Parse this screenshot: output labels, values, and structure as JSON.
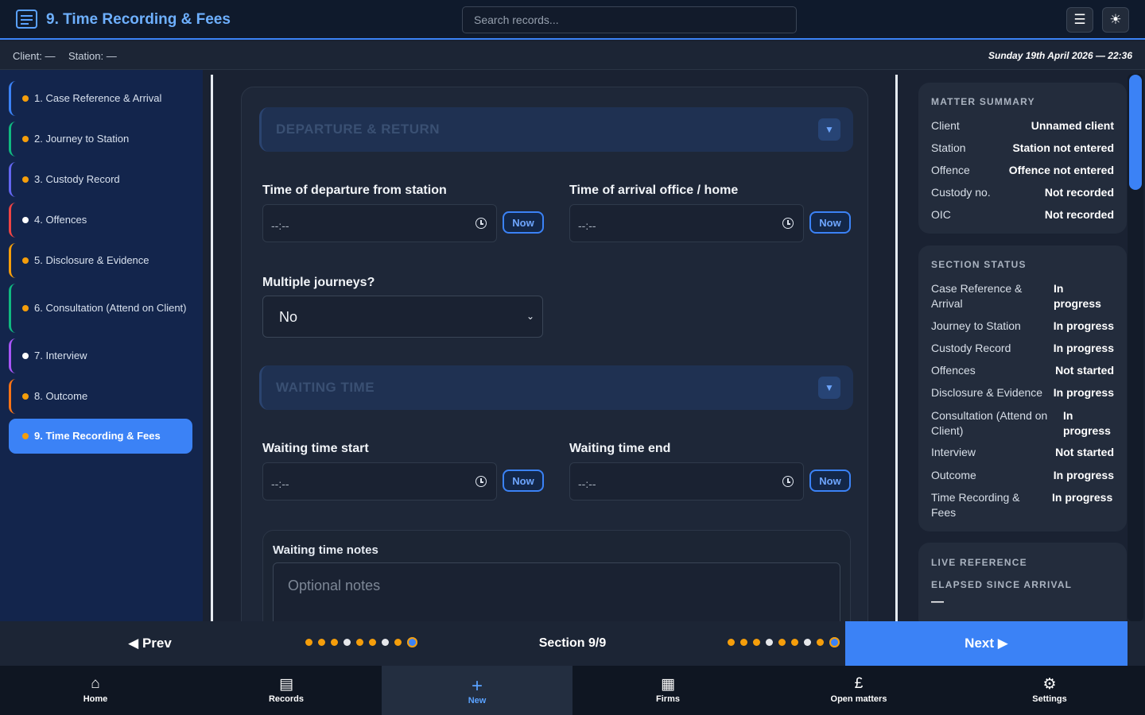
{
  "header": {
    "title": "9. Time Recording & Fees",
    "search_placeholder": "Search records...",
    "menu_icon": "hamburger-icon",
    "theme_icon": "sun-icon"
  },
  "infobar": {
    "client": "Client: —",
    "station": "Station: —",
    "datetime": "Sunday 19th April 2026 — 22:36"
  },
  "sidebar": {
    "items": [
      {
        "label": "1. Case Reference & Arrival",
        "accent": "#3b82f6",
        "dot": "#f59e0b"
      },
      {
        "label": "2. Journey to Station",
        "accent": "#10b981",
        "dot": "#f59e0b"
      },
      {
        "label": "3. Custody Record",
        "accent": "#6366f1",
        "dot": "#f59e0b"
      },
      {
        "label": "4. Offences",
        "accent": "#ef4444",
        "dot": "#ffffff"
      },
      {
        "label": "5. Disclosure & Evidence",
        "accent": "#f59e0b",
        "dot": "#f59e0b"
      },
      {
        "label": "6. Consultation (Attend on Client)",
        "accent": "#10b981",
        "dot": "#f59e0b"
      },
      {
        "label": "7. Interview",
        "accent": "#a855f7",
        "dot": "#ffffff"
      },
      {
        "label": "8. Outcome",
        "accent": "#f97316",
        "dot": "#f59e0b"
      },
      {
        "label": "9. Time Recording & Fees",
        "accent": "#3b82f6",
        "dot": "#f59e0b",
        "active": true
      }
    ]
  },
  "main": {
    "departure_section": {
      "title": "DEPARTURE & RETURN"
    },
    "departure_time": {
      "label": "Time of departure from station",
      "value": "--:--",
      "now": "Now"
    },
    "arrival_time": {
      "label": "Time of arrival office / home",
      "value": "--:--",
      "now": "Now"
    },
    "multiple_journeys": {
      "label": "Multiple journeys?",
      "value": "No"
    },
    "waiting_section": {
      "title": "WAITING TIME"
    },
    "waiting_start": {
      "label": "Waiting time start",
      "value": "--:--",
      "now": "Now"
    },
    "waiting_end": {
      "label": "Waiting time end",
      "value": "--:--",
      "now": "Now"
    },
    "waiting_notes": {
      "label": "Waiting time notes",
      "placeholder": "Optional notes"
    }
  },
  "matter_summary": {
    "title": "MATTER SUMMARY",
    "rows": [
      {
        "key": "Client",
        "value": "Unnamed client"
      },
      {
        "key": "Station",
        "value": "Station not entered"
      },
      {
        "key": "Offence",
        "value": "Offence not entered"
      },
      {
        "key": "Custody no.",
        "value": "Not recorded"
      },
      {
        "key": "OIC",
        "value": "Not recorded"
      }
    ]
  },
  "section_status": {
    "title": "SECTION STATUS",
    "rows": [
      {
        "key": "Case Reference & Arrival",
        "value": "In progress"
      },
      {
        "key": "Journey to Station",
        "value": "In progress"
      },
      {
        "key": "Custody Record",
        "value": "In progress"
      },
      {
        "key": "Offences",
        "value": "Not started"
      },
      {
        "key": "Disclosure & Evidence",
        "value": "In progress"
      },
      {
        "key": "Consultation (Attend on Client)",
        "value": "In progress"
      },
      {
        "key": "Interview",
        "value": "Not started"
      },
      {
        "key": "Outcome",
        "value": "In progress"
      },
      {
        "key": "Time Recording & Fees",
        "value": "In progress"
      }
    ]
  },
  "live_reference": {
    "title": "LIVE REFERENCE",
    "elapsed_label": "ELAPSED SINCE ARRIVAL",
    "elapsed_value": "—"
  },
  "footer": {
    "prev": "◀ Prev",
    "section": "Section 9/9",
    "next": "Next ▶",
    "dot_colors": [
      "#f59e0b",
      "#f59e0b",
      "#f59e0b",
      "#e5e7eb",
      "#f59e0b",
      "#f59e0b",
      "#e5e7eb",
      "#f59e0b",
      "#3b82f6"
    ]
  },
  "bottom_nav": [
    {
      "label": "Home",
      "icon": "home-icon"
    },
    {
      "label": "Records",
      "icon": "document-icon"
    },
    {
      "label": "New",
      "icon": "plus-icon",
      "active": true
    },
    {
      "label": "Firms",
      "icon": "building-icon"
    },
    {
      "label": "Open matters",
      "icon": "pound-icon"
    },
    {
      "label": "Settings",
      "icon": "gear-icon"
    }
  ]
}
